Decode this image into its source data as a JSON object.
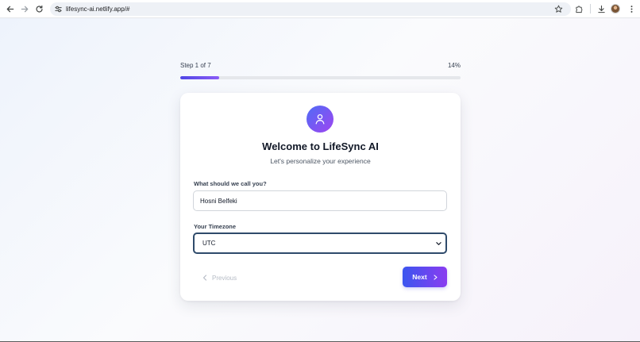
{
  "browser": {
    "url": "lifesync-ai.netlify.app/#",
    "back_icon": "arrow-left-icon",
    "forward_icon": "arrow-right-icon",
    "reload_icon": "reload-icon",
    "site_info_icon": "tune-icon",
    "bookmark_icon": "star-icon",
    "extensions_icon": "puzzle-icon",
    "downloads_icon": "download-icon",
    "menu_icon": "three-dots-icon"
  },
  "onboarding": {
    "step_label": "Step 1 of 7",
    "progress_label": "14%",
    "progress_fraction": 0.14,
    "icon": "user-icon",
    "title": "Welcome to LifeSync AI",
    "subtitle": "Let's personalize your experience",
    "name_label": "What should we call you?",
    "name_value": "Hosni Belfeki",
    "timezone_label": "Your Timezone",
    "timezone_value": "UTC",
    "previous_label": "Previous",
    "next_label": "Next"
  },
  "colors": {
    "accent_start": "#3b55ef",
    "accent_end": "#8a3cf0",
    "progress_start": "#4f46e5",
    "progress_end": "#8b5cf6"
  }
}
